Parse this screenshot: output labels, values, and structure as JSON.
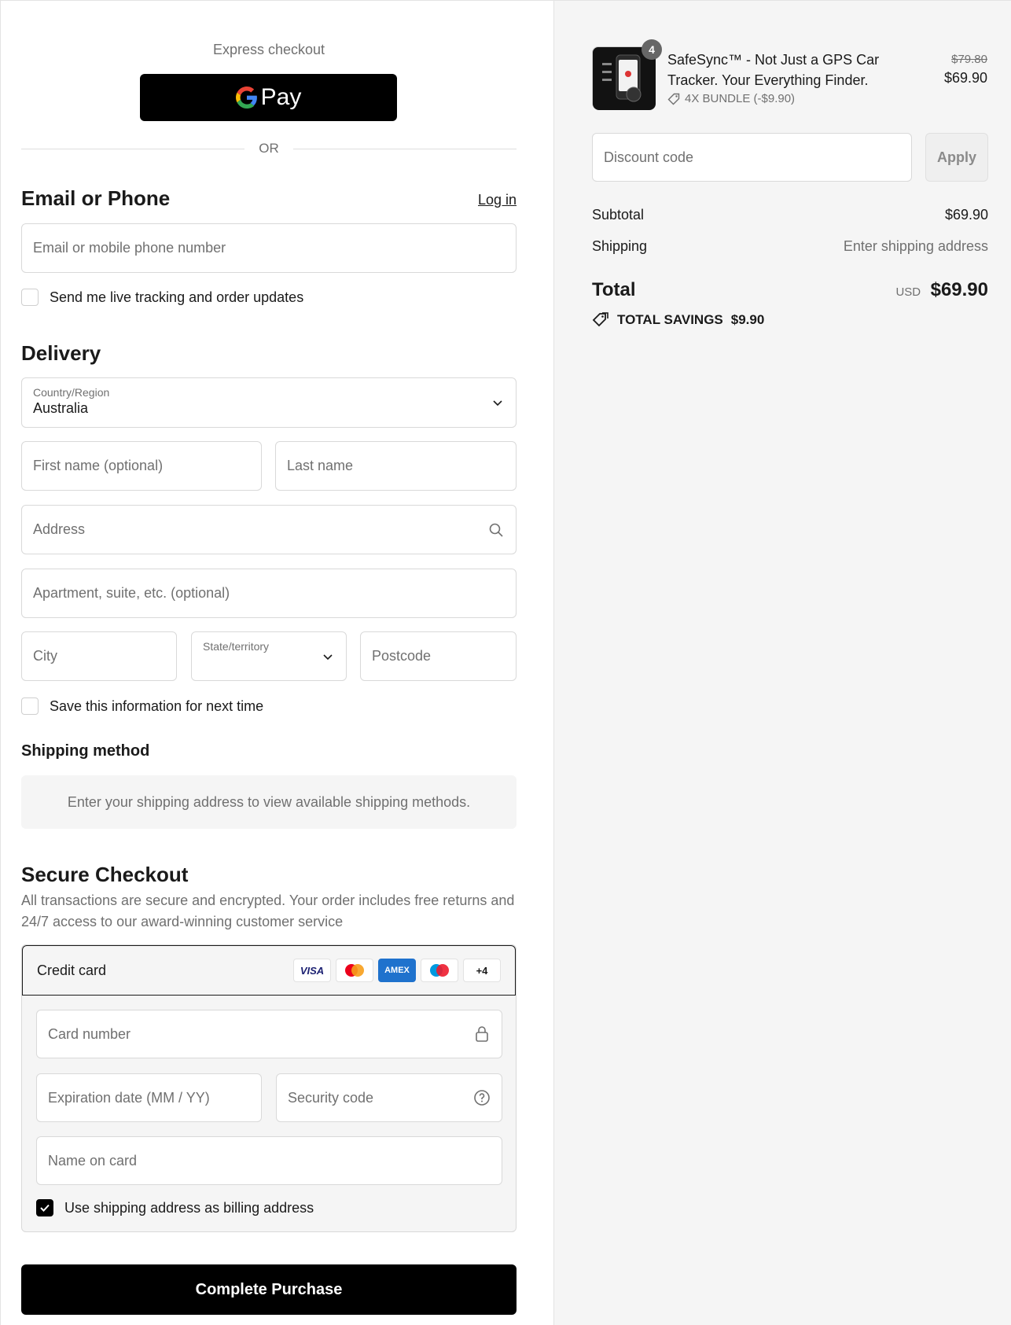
{
  "express": {
    "label": "Express checkout",
    "gpay_text": "Pay",
    "or": "OR"
  },
  "contact": {
    "title": "Email or Phone",
    "login": "Log in",
    "email_placeholder": "Email or mobile phone number",
    "updates_label": "Send me live tracking and order updates"
  },
  "delivery": {
    "title": "Delivery",
    "country_label": "Country/Region",
    "country_value": "Australia",
    "first_name": "First name (optional)",
    "last_name": "Last name",
    "address": "Address",
    "apartment": "Apartment, suite, etc. (optional)",
    "city": "City",
    "state_label": "State/territory",
    "postcode": "Postcode",
    "save_label": "Save this information for next time"
  },
  "shipping": {
    "title": "Shipping method",
    "message": "Enter your shipping address to view available shipping methods."
  },
  "payment": {
    "title": "Secure Checkout",
    "description": "All transactions are secure and encrypted. Your order includes free returns and 24/7 access to our award-winning customer service",
    "method_label": "Credit card",
    "logos": {
      "visa": "VISA",
      "amex": "AMEX",
      "more": "+4"
    },
    "card_number": "Card number",
    "expiry": "Expiration date (MM / YY)",
    "security": "Security code",
    "name_on_card": "Name on card",
    "billing_label": "Use shipping address as billing address",
    "billing_checked": true
  },
  "complete_button": "Complete Purchase",
  "summary": {
    "product_title": "SafeSync™ - Not Just a GPS Car Tracker. Your Everything Finder.",
    "quantity": "4",
    "bundle": "4X BUNDLE (-$9.90)",
    "compare_price": "$79.80",
    "price": "$69.90",
    "discount_placeholder": "Discount code",
    "apply": "Apply",
    "subtotal_label": "Subtotal",
    "subtotal_value": "$69.90",
    "shipping_label": "Shipping",
    "shipping_value": "Enter shipping address",
    "total_label": "Total",
    "currency": "USD",
    "total_value": "$69.90",
    "savings_label": "TOTAL SAVINGS",
    "savings_value": "$9.90"
  },
  "colors": {
    "primary": "#000000",
    "muted": "#707070",
    "panel": "#f5f5f5",
    "border": "#d9d9d9"
  }
}
